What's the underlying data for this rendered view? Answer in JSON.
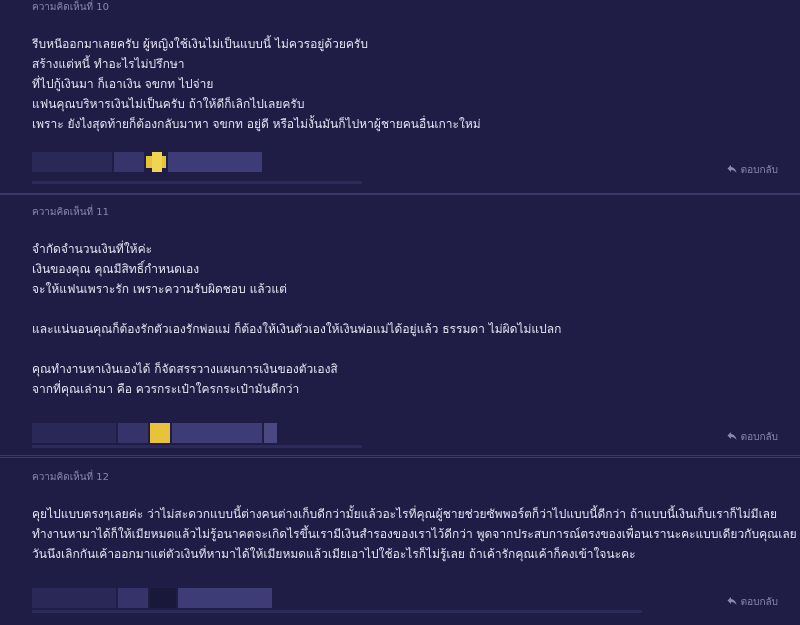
{
  "colors": {
    "background": "#1f1d46",
    "text": "#e8e6f2",
    "muted": "#8a87b0",
    "divider": "#3a3868",
    "avatar_yellow": "#e8c23a"
  },
  "reply_label": "ตอบกลับ",
  "reply_icon": "reply-arrow-icon",
  "comments": [
    {
      "header": "ความคิดเห็นที่ 10",
      "lines": [
        "รีบหนีออกมาเลยครับ ผู้หญิงใช้เงินไม่เป็นแบบนี้ ไม่ควรอยู่ด้วยครับ",
        "สร้างแต่หนี้ ทำอะไรไม่ปรึกษา",
        "ที่ไปกู้เงินมา ก็เอาเงิน จขกท ไปจ่าย",
        "แฟนคุณบริหารเงินไม่เป็นครับ ถ้าให้ดีก็เลิกไปเลยครับ",
        "เพราะ ยังไงสุดท้ายก็ต้องกลับมาหา จขกท อยู่ดี หรือไม่งั้นมันก็ไปหาผู้ชายคนอื่นเกาะใหม่"
      ]
    },
    {
      "header": "ความคิดเห็นที่ 11",
      "lines": [
        "จำกัดจำนวนเงินที่ให้ค่ะ",
        "เงินของคุณ คุณมีสิทธิ์กำหนดเอง",
        "จะให้แฟนเพราะรัก เพราะความรับผิดชอบ แล้วแต่",
        "",
        "และแน่นอนคุณก็ต้องรักตัวเองรักพ่อแม่ ก็ต้องให้เงินตัวเองให้เงินพ่อแม่ได้อยู่แล้ว ธรรมดา ไม่ผิดไม่แปลก",
        "",
        "คุณทำงานหาเงินเองได้ ก็จัดสรรวางแผนการเงินของตัวเองสิ",
        "จากที่คุณเล่ามา คือ ควรกระเป๋าใครกระเป๋ามันดีกว่า"
      ]
    },
    {
      "header": "ความคิดเห็นที่ 12",
      "lines": [
        "คุยไปแบบตรงๆเลยค่ะ ว่าไม่สะดวกแบบนี้ต่างคนต่างเก็บดีกว่ามั้ยแล้วอะไรที่คุณผู้ชายช่วยซัพพอร์ตก็ว่าไปแบบนี้ดีกว่า ถ้าแบบนี้เงินเก็บเราก็ไม่มีเลย",
        "ทำงานหามาได้ก็ให้เมียหมดแล้วไม่รู้อนาคตจะเกิดไรขึ้นเรามีเงินสำรองของเราไว้ดีกว่า พูดจากประสบการณ์ตรงของเพื่อนเรานะคะแบบเดียวกับคุณเลย",
        "วันนึงเลิกกันเค้าออกมาแต่ตัวเงินที่หามาได้ให้เมียหมดแล้วเมียเอาไปใช้อะไรก็ไม่รู้เลย ถ้าเค้ารักคุณเค้าก็คงเข้าใจนะคะ"
      ]
    }
  ]
}
